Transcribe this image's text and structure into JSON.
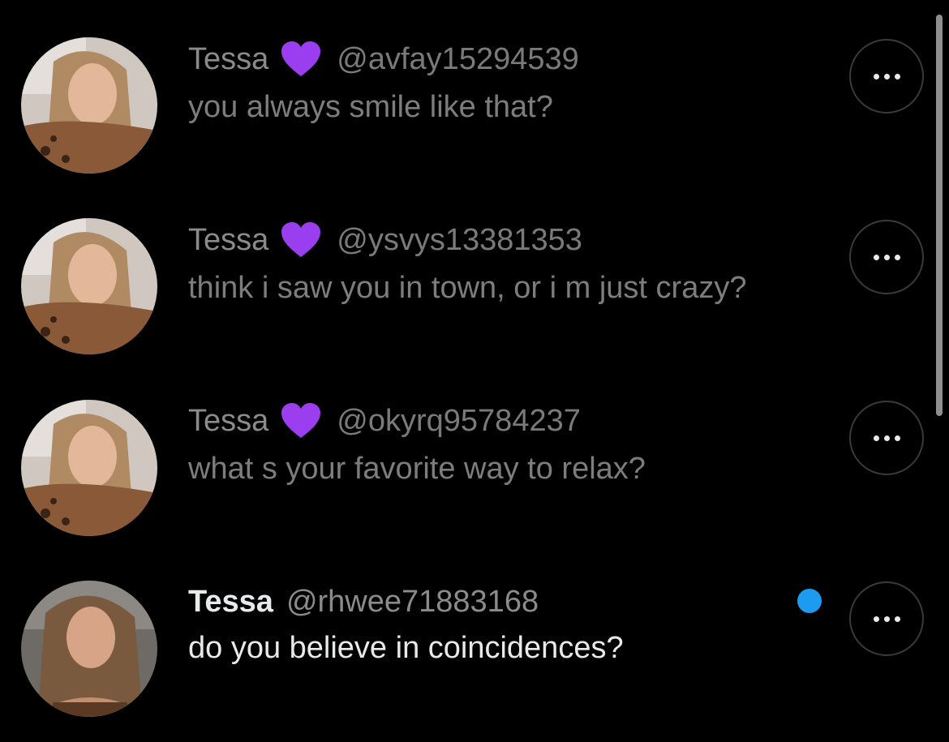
{
  "conversations": [
    {
      "name": "Tessa",
      "badge": "purple-heart",
      "handle": "@avfay15294539",
      "message": "you always smile like that?",
      "unread": false
    },
    {
      "name": "Tessa",
      "badge": "purple-heart",
      "handle": "@ysvys13381353",
      "message": "think i saw you in town, or i m just crazy?",
      "unread": false
    },
    {
      "name": "Tessa",
      "badge": "purple-heart",
      "handle": "@okyrq95784237",
      "message": "what s your favorite way to relax?",
      "unread": false
    },
    {
      "name": "Tessa",
      "badge": "",
      "handle": "@rhwee71883168",
      "message": "do you believe in coincidences?",
      "unread": true
    }
  ],
  "colors": {
    "background": "#000000",
    "heart": "#9b3ef0",
    "unread_dot": "#1d9bf0",
    "read_text": "#7d7d7d",
    "unread_text": "#e7e9ea"
  },
  "icons": {
    "more": "ellipsis-icon",
    "badge": "purple-heart-icon"
  }
}
